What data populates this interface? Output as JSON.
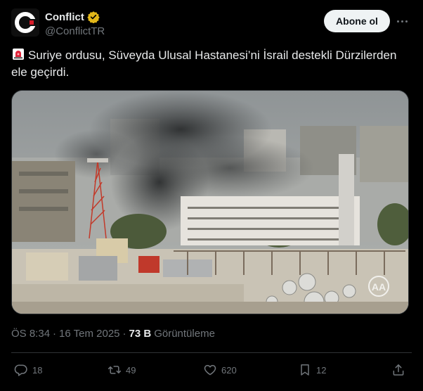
{
  "author": {
    "display_name": "Conflict",
    "handle": "@ConflictTR",
    "verified": true,
    "verified_color": "#e2b719",
    "avatar_letter": "C",
    "avatar_accent": "#d91c2a"
  },
  "follow_label": "Abone ol",
  "tweet": {
    "emoji": "siren-emoji",
    "text": "Suriye ordusu, Süveyda Ulusal Hastanesi’ni İsrail destekli Dürzilerden ele geçirdi."
  },
  "media": {
    "description_icon": "photo",
    "watermark": "AA"
  },
  "meta": {
    "time": "ÖS 8:34",
    "sep1": "·",
    "date": "16 Tem 2025",
    "sep2": "·",
    "views_count": "73 B",
    "views_label": "Görüntüleme"
  },
  "actions": {
    "reply_count": "18",
    "repost_count": "49",
    "like_count": "620",
    "bookmark_count": "12"
  },
  "colors": {
    "background": "#000000",
    "text": "#e7e9ea",
    "secondary": "#71767b",
    "border": "#2f3336"
  }
}
